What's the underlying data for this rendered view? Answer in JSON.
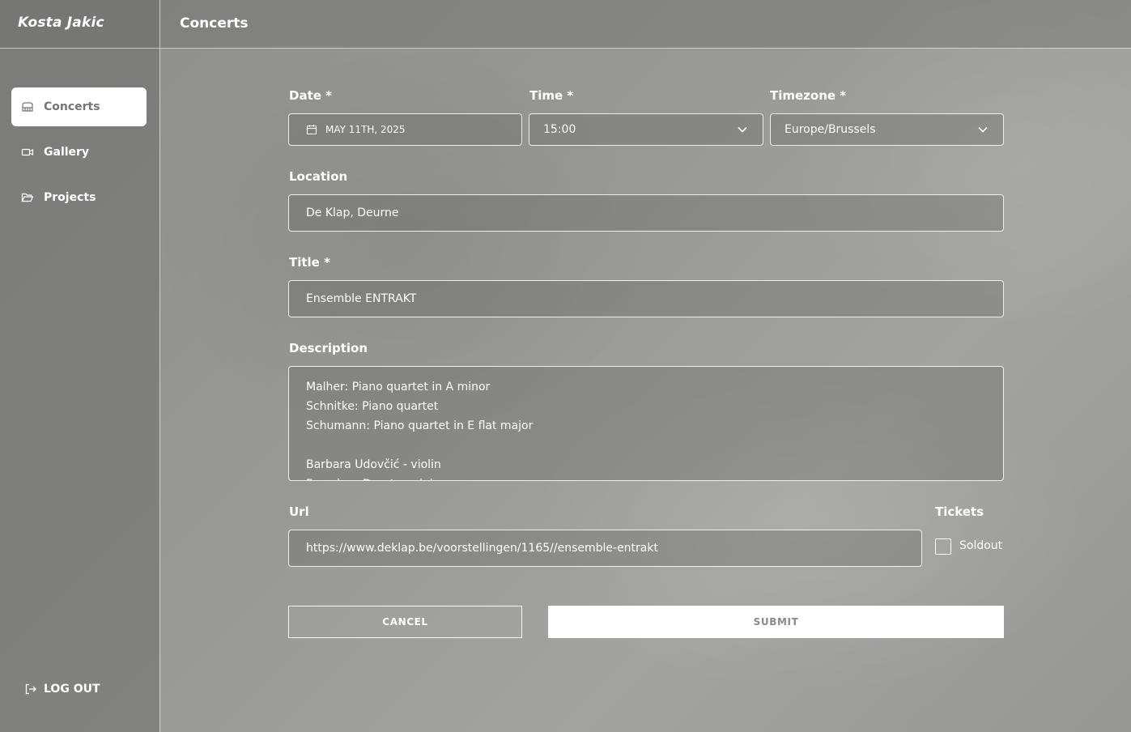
{
  "app": {
    "brand": "Kosta Jakic"
  },
  "header": {
    "title": "Concerts"
  },
  "sidebar": {
    "items": [
      {
        "label": "Concerts",
        "icon": "piano-icon",
        "active": true
      },
      {
        "label": "Gallery",
        "icon": "video-camera-icon",
        "active": false
      },
      {
        "label": "Projects",
        "icon": "folder-open-icon",
        "active": false
      }
    ],
    "logout_label": "LOG OUT"
  },
  "form": {
    "date": {
      "label": "Date *",
      "value": "MAY 11TH, 2025"
    },
    "time": {
      "label": "Time *",
      "value": "15:00"
    },
    "timezone": {
      "label": "Timezone *",
      "value": "Europe/Brussels"
    },
    "location": {
      "label": "Location",
      "value": "De Klap, Deurne"
    },
    "title": {
      "label": "Title *",
      "value": "Ensemble ENTRAKT"
    },
    "description": {
      "label": "Description",
      "lines": [
        "Malher: Piano quartet in A minor",
        "Schnitke: Piano quartet",
        "Schumann: Piano quartet in E flat major",
        "",
        "Barbara Udovčić - violin",
        "Francisco Duarte - viola"
      ]
    },
    "url": {
      "label": "Url",
      "value": "https://www.deklap.be/voorstellingen/1165//ensemble-entrakt"
    },
    "tickets": {
      "label": "Tickets",
      "soldout_label": "Soldout",
      "soldout_checked": false
    },
    "cancel_label": "CANCEL",
    "submit_label": "SUBMIT"
  }
}
